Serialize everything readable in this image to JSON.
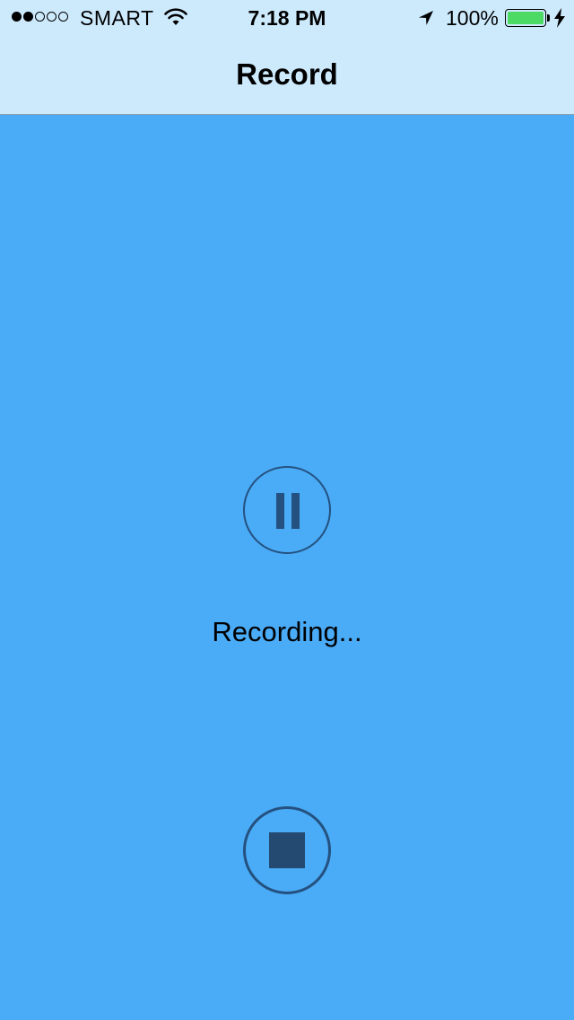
{
  "status_bar": {
    "signal_dots_filled": 2,
    "signal_dots_total": 5,
    "carrier": "SMART",
    "wifi_icon": "wifi-icon",
    "time": "7:18 PM",
    "location_icon": "location-arrow-icon",
    "battery_percent_text": "100%",
    "battery_level": 1.0,
    "battery_icon": "battery-icon",
    "charging_icon": "bolt-icon"
  },
  "nav": {
    "title": "Record"
  },
  "main": {
    "pause_icon": "pause-icon",
    "status_text": "Recording...",
    "stop_icon": "stop-icon"
  },
  "colors": {
    "background": "#4aabf7",
    "header_background": "#cdeafd",
    "control_stroke": "#24517f",
    "battery_fill": "#4cd964"
  }
}
